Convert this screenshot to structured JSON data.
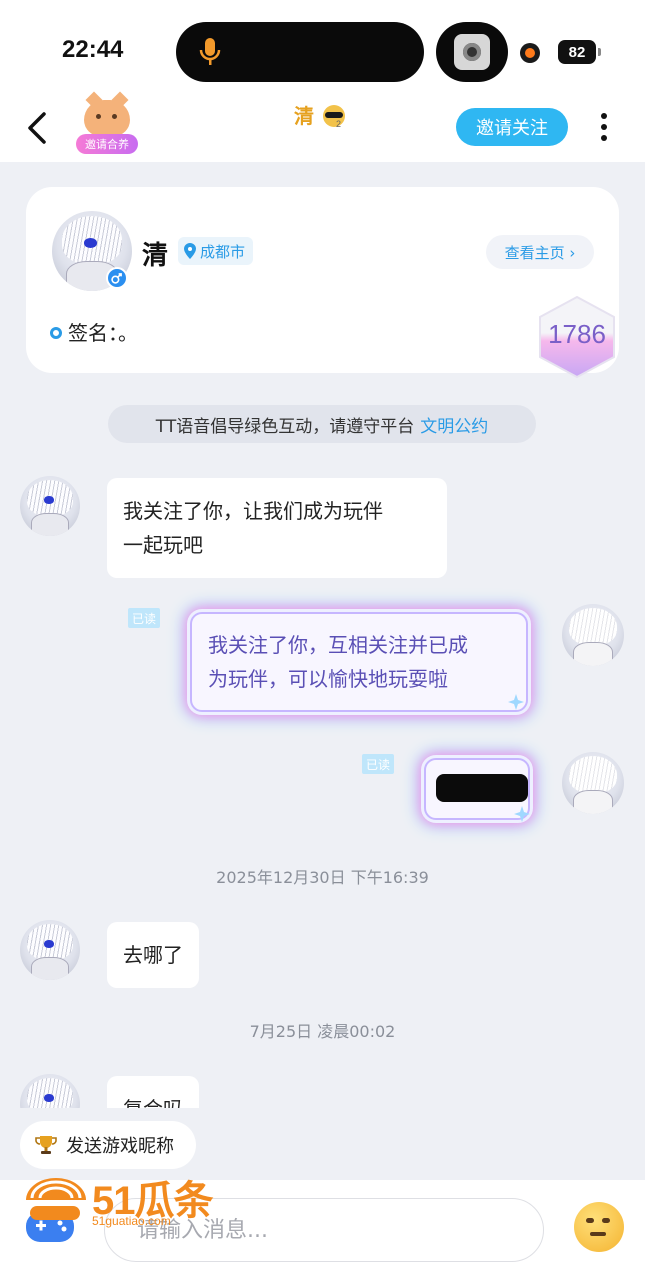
{
  "status_bar": {
    "time": "22:44",
    "battery": "82"
  },
  "nav": {
    "invite_label": "邀请合养",
    "title": "清",
    "follow_label": "邀请关注"
  },
  "profile": {
    "name": "清",
    "location": "成都市",
    "homepage_label": "查看主页 ›",
    "signature": "签名：。",
    "level": "1786"
  },
  "notice": {
    "text": "TT语音倡导绿色互动，请遵守平台",
    "link": "文明公约"
  },
  "messages": [
    {
      "side": "in",
      "text_lines": [
        "我关注了你，让我们成为玩伴",
        "一起玩吧"
      ]
    },
    {
      "side": "out",
      "read": "已读",
      "text_lines": [
        "我关注了你，互相关注并已成",
        "为玩伴，可以愉快地玩耍啦"
      ]
    },
    {
      "side": "out",
      "read": "已读",
      "redacted": true
    },
    {
      "timestamp": "2025年12月30日 下午16:39"
    },
    {
      "side": "in",
      "text": "去哪了"
    },
    {
      "timestamp": "7月25日 凌晨00:02"
    },
    {
      "side": "in",
      "text": "复合吗"
    }
  ],
  "quick_reply": {
    "label": "发送游戏昵称"
  },
  "input": {
    "placeholder": "请输入消息..."
  },
  "watermark": {
    "brand": "51瓜条",
    "site": "51guatiao.com"
  },
  "colors": {
    "accent": "#2fb7f2",
    "title_gold": "#e6a11f",
    "link": "#2a9be6",
    "out_text": "#5a4fb5"
  }
}
